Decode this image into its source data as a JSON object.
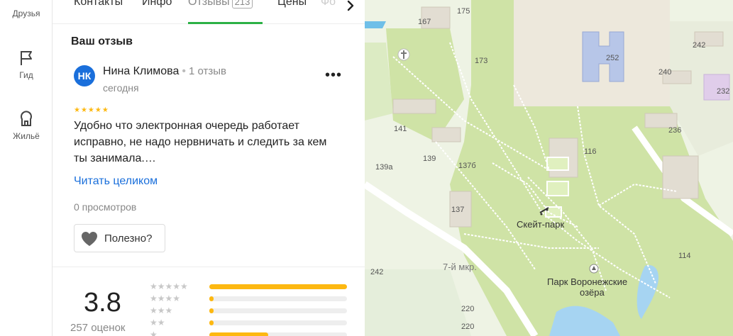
{
  "rail": {
    "items": [
      {
        "label": "Друзья",
        "icon": "friends-icon"
      },
      {
        "label": "Гид",
        "icon": "flag-icon"
      },
      {
        "label": "Жильё",
        "icon": "house-icon"
      }
    ]
  },
  "tabs": [
    {
      "label": "Контакты"
    },
    {
      "label": "Инфо"
    },
    {
      "label": "Отзывы",
      "count": "213",
      "active": true
    },
    {
      "label": "Цены"
    },
    {
      "label": "Фо"
    }
  ],
  "review": {
    "section_title": "Ваш отзыв",
    "avatar_initials": "НК",
    "author": "Нина Климова",
    "author_reviews": "1 отзыв",
    "date": "сегодня",
    "more": "•••",
    "rating": 5,
    "stars_text": "★★★★★",
    "text": "Удобно что электронная очередь работает исправно, не надо нервничать и следить за кем ты занимала.…",
    "read_more": "Читать целиком",
    "views": "0 просмотров",
    "useful_label": "Полезно?"
  },
  "summary": {
    "rating": "3.8",
    "count": "257 оценок",
    "distribution": [
      {
        "stars": "★★★★★",
        "fraction": 1.0
      },
      {
        "stars": "★★★★",
        "fraction": 0.03
      },
      {
        "stars": "★★★",
        "fraction": 0.03
      },
      {
        "stars": "★★",
        "fraction": 0.03
      },
      {
        "stars": "★",
        "fraction": 0.43
      }
    ]
  },
  "map": {
    "labels": [
      {
        "text": "175"
      },
      {
        "text": "167"
      },
      {
        "text": "173"
      },
      {
        "text": "252"
      },
      {
        "text": "242"
      },
      {
        "text": "240"
      },
      {
        "text": "232"
      },
      {
        "text": "236"
      },
      {
        "text": "141"
      },
      {
        "text": "139"
      },
      {
        "text": "137б"
      },
      {
        "text": "139а"
      },
      {
        "text": "116"
      },
      {
        "text": "137"
      },
      {
        "text": "114"
      },
      {
        "text": "242"
      },
      {
        "text": "220"
      },
      {
        "text": "220"
      }
    ],
    "skate_park": "Скейт-парк",
    "park_line1": "Парк Воронежские",
    "park_line2": "озёра",
    "street": "7-й мкр."
  }
}
